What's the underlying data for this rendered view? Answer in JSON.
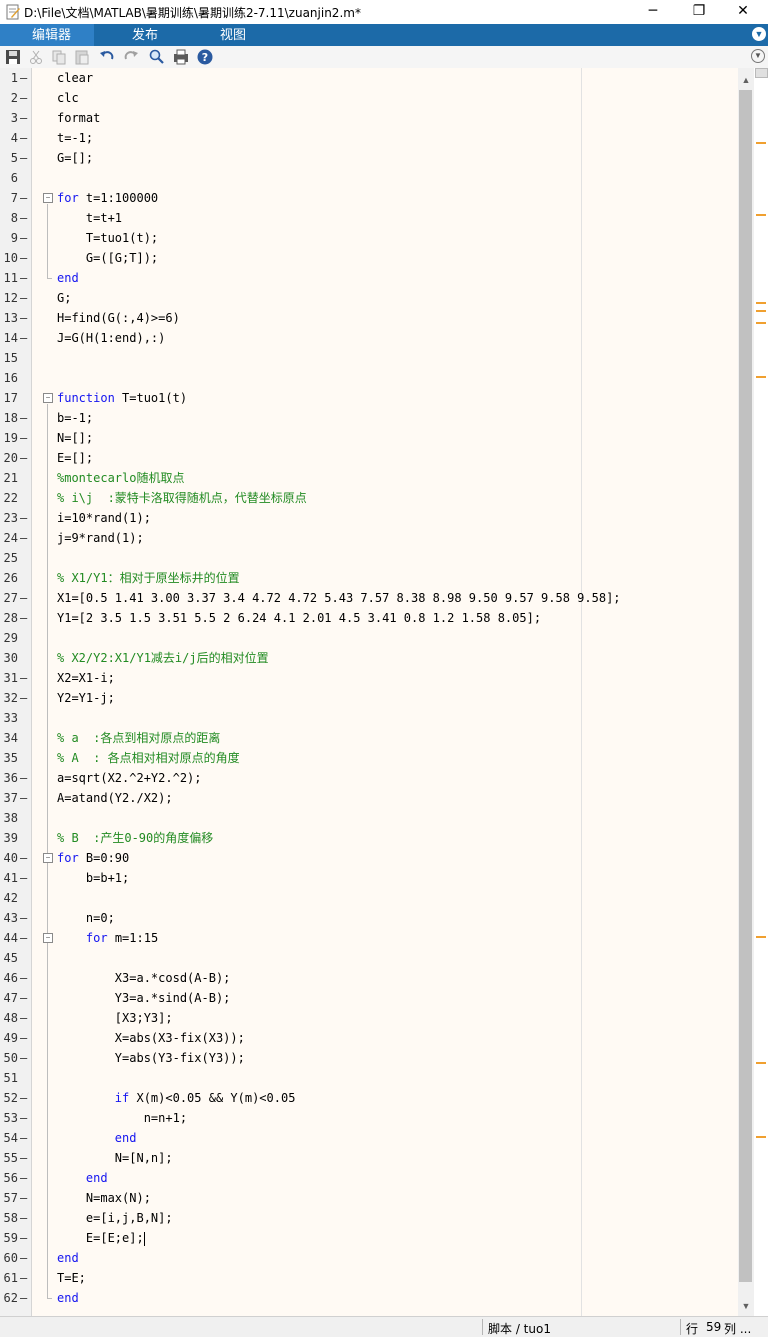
{
  "window": {
    "title": "D:\\File\\文档\\MATLAB\\暑期训练\\暑期训练2-7.11\\zuanjin2.m*",
    "minimize_glyph": "─",
    "restore_glyph": "❐",
    "close_glyph": "✕"
  },
  "ribbon": {
    "tabs": [
      {
        "label": "编辑器",
        "active": true
      },
      {
        "label": "发布",
        "active": false
      },
      {
        "label": "视图",
        "active": false
      }
    ],
    "collapse_icon": "chevron-down-icon"
  },
  "toolbar": {
    "buttons": [
      "save-icon",
      "cut-icon",
      "copy-icon",
      "paste-icon",
      "undo-icon",
      "redo-icon",
      "find-icon",
      "print-icon",
      "help-icon"
    ]
  },
  "editor": {
    "lines": [
      {
        "n": "1",
        "exec": true,
        "text": "clear",
        "type": "code"
      },
      {
        "n": "2",
        "exec": true,
        "text": "clc",
        "type": "code"
      },
      {
        "n": "3",
        "exec": true,
        "text": "format",
        "type": "code"
      },
      {
        "n": "4",
        "exec": true,
        "text": "t=-1;",
        "type": "code"
      },
      {
        "n": "5",
        "exec": true,
        "text": "G=[];",
        "type": "code"
      },
      {
        "n": "6",
        "exec": false,
        "text": "",
        "type": "code"
      },
      {
        "n": "7",
        "exec": true,
        "text": "for t=1:100000",
        "type": "code"
      },
      {
        "n": "8",
        "exec": true,
        "text": "    t=t+1",
        "type": "code"
      },
      {
        "n": "9",
        "exec": true,
        "text": "    T=tuo1(t);",
        "type": "code"
      },
      {
        "n": "10",
        "exec": true,
        "text": "    G=([G;T]);",
        "type": "code"
      },
      {
        "n": "11",
        "exec": true,
        "text": "end",
        "type": "code"
      },
      {
        "n": "12",
        "exec": true,
        "text": "G;",
        "type": "code"
      },
      {
        "n": "13",
        "exec": true,
        "text": "H=find(G(:,4)>=6)",
        "type": "code"
      },
      {
        "n": "14",
        "exec": true,
        "text": "J=G(H(1:end),:)",
        "type": "code"
      },
      {
        "n": "15",
        "exec": false,
        "text": "",
        "type": "code"
      },
      {
        "n": "16",
        "exec": false,
        "text": "",
        "type": "code"
      },
      {
        "n": "17",
        "exec": false,
        "text": "function T=tuo1(t)",
        "type": "code"
      },
      {
        "n": "18",
        "exec": true,
        "text": "b=-1;",
        "type": "code"
      },
      {
        "n": "19",
        "exec": true,
        "text": "N=[];",
        "type": "code"
      },
      {
        "n": "20",
        "exec": true,
        "text": "E=[];",
        "type": "code"
      },
      {
        "n": "21",
        "exec": false,
        "text": "%montecarlo随机取点",
        "type": "comment"
      },
      {
        "n": "22",
        "exec": false,
        "text": "% i\\j  :蒙特卡洛取得随机点，代替坐标原点",
        "type": "comment"
      },
      {
        "n": "23",
        "exec": true,
        "text": "i=10*rand(1);",
        "type": "code"
      },
      {
        "n": "24",
        "exec": true,
        "text": "j=9*rand(1);",
        "type": "code"
      },
      {
        "n": "25",
        "exec": false,
        "text": "",
        "type": "code"
      },
      {
        "n": "26",
        "exec": false,
        "text": "% X1/Y1：相对于原坐标井的位置",
        "type": "comment"
      },
      {
        "n": "27",
        "exec": true,
        "text": "X1=[0.5 1.41 3.00 3.37 3.4 4.72 4.72 5.43 7.57 8.38 8.98 9.50 9.57 9.58 9.58];",
        "type": "code"
      },
      {
        "n": "28",
        "exec": true,
        "text": "Y1=[2 3.5 1.5 3.51 5.5 2 6.24 4.1 2.01 4.5 3.41 0.8 1.2 1.58 8.05];",
        "type": "code"
      },
      {
        "n": "29",
        "exec": false,
        "text": "",
        "type": "code"
      },
      {
        "n": "30",
        "exec": false,
        "text": "% X2/Y2:X1/Y1减去i/j后的相对位置",
        "type": "comment"
      },
      {
        "n": "31",
        "exec": true,
        "text": "X2=X1-i;",
        "type": "code"
      },
      {
        "n": "32",
        "exec": true,
        "text": "Y2=Y1-j;",
        "type": "code"
      },
      {
        "n": "33",
        "exec": false,
        "text": "",
        "type": "code"
      },
      {
        "n": "34",
        "exec": false,
        "text": "% a  :各点到相对原点的距离",
        "type": "comment"
      },
      {
        "n": "35",
        "exec": false,
        "text": "% A  : 各点相对相对原点的角度",
        "type": "comment"
      },
      {
        "n": "36",
        "exec": true,
        "text": "a=sqrt(X2.^2+Y2.^2);",
        "type": "code"
      },
      {
        "n": "37",
        "exec": true,
        "text": "A=atand(Y2./X2);",
        "type": "code"
      },
      {
        "n": "38",
        "exec": false,
        "text": "",
        "type": "code"
      },
      {
        "n": "39",
        "exec": false,
        "text": "% B  :产生0-90的角度偏移",
        "type": "comment"
      },
      {
        "n": "40",
        "exec": true,
        "text": "for B=0:90",
        "type": "code"
      },
      {
        "n": "41",
        "exec": true,
        "text": "    b=b+1;",
        "type": "code"
      },
      {
        "n": "42",
        "exec": false,
        "text": "",
        "type": "code"
      },
      {
        "n": "43",
        "exec": true,
        "text": "    n=0;",
        "type": "code"
      },
      {
        "n": "44",
        "exec": true,
        "text": "    for m=1:15",
        "type": "code"
      },
      {
        "n": "45",
        "exec": false,
        "text": "",
        "type": "code"
      },
      {
        "n": "46",
        "exec": true,
        "text": "        X3=a.*cosd(A-B);",
        "type": "code"
      },
      {
        "n": "47",
        "exec": true,
        "text": "        Y3=a.*sind(A-B);",
        "type": "code"
      },
      {
        "n": "48",
        "exec": true,
        "text": "        [X3;Y3];",
        "type": "code"
      },
      {
        "n": "49",
        "exec": true,
        "text": "        X=abs(X3-fix(X3));",
        "type": "code"
      },
      {
        "n": "50",
        "exec": true,
        "text": "        Y=abs(Y3-fix(Y3));",
        "type": "code"
      },
      {
        "n": "51",
        "exec": false,
        "text": "",
        "type": "code"
      },
      {
        "n": "52",
        "exec": true,
        "text": "        if X(m)<0.05 && Y(m)<0.05",
        "type": "code"
      },
      {
        "n": "53",
        "exec": true,
        "text": "            n=n+1;",
        "type": "code"
      },
      {
        "n": "54",
        "exec": true,
        "text": "        end",
        "type": "code"
      },
      {
        "n": "55",
        "exec": true,
        "text": "        N=[N,n];",
        "type": "code"
      },
      {
        "n": "56",
        "exec": true,
        "text": "    end",
        "type": "code"
      },
      {
        "n": "57",
        "exec": true,
        "text": "    N=max(N);",
        "type": "code"
      },
      {
        "n": "58",
        "exec": true,
        "text": "    e=[i,j,B,N];",
        "type": "code"
      },
      {
        "n": "59",
        "exec": true,
        "text": "    E=[E;e];",
        "type": "code"
      },
      {
        "n": "60",
        "exec": true,
        "text": "end",
        "type": "code"
      },
      {
        "n": "61",
        "exec": true,
        "text": "T=E;",
        "type": "code"
      },
      {
        "n": "62",
        "exec": true,
        "text": "end",
        "type": "code"
      }
    ],
    "keywords": [
      "for",
      "end",
      "if",
      "function"
    ],
    "colors": {
      "keyword": "#1515f0",
      "comment": "#228b22",
      "background": "#fffaf4",
      "warning": "#f0a030"
    }
  },
  "statusbar": {
    "script_label": "脚本 / tuo1",
    "line_label": "行",
    "line_value": "59",
    "col_label": "列 ..."
  }
}
